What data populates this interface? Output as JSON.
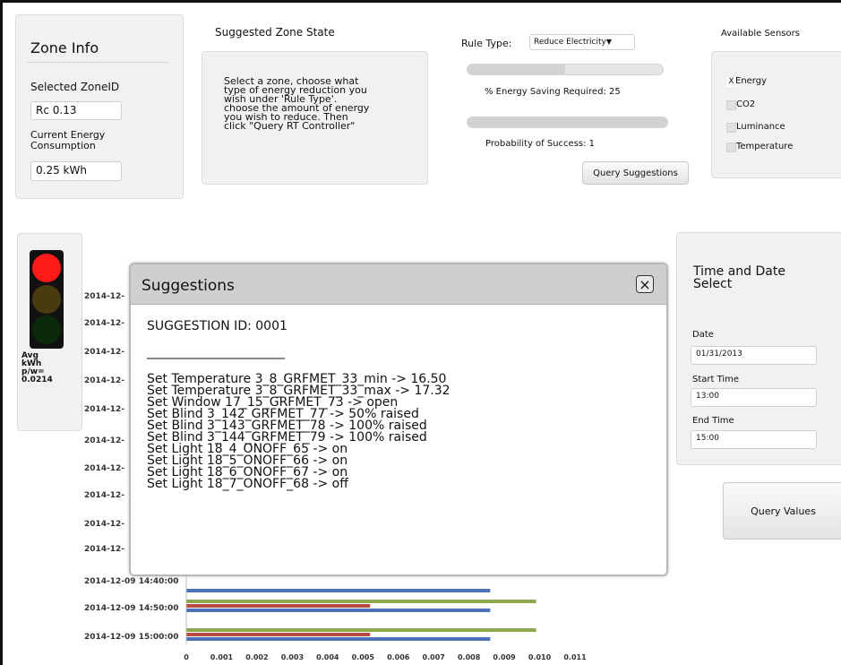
{
  "zone_info": {
    "title": "Zone Info",
    "selected_zone_label": "Selected ZoneID",
    "selected_zone_value": "Rc 0.13",
    "consumption_label_line1": "Current Energy",
    "consumption_label_line2": "Consumption",
    "consumption_value": "0.25 kWh"
  },
  "suggested_state": {
    "title": "Suggested Zone State",
    "instructions": [
      "Select a zone, choose what",
      "type of energy reduction you",
      "wish under 'Rule Type'.",
      "choose the amount of energy",
      "you wish to reduce. Then",
      "click \"Query RT Controller\""
    ]
  },
  "rule": {
    "label": "Rule Type:",
    "selected": "Reduce Electricity",
    "saving_label": "% Energy Saving Required: 25",
    "saving_value": 25,
    "probability_label": "Probability of Success: 1",
    "probability_value": 1,
    "query_button": "Query Suggestions"
  },
  "sensors": {
    "title": "Available Sensors",
    "items": [
      {
        "label": "Energy",
        "checked": true,
        "mark": "X"
      },
      {
        "label": "CO2",
        "checked": false,
        "mark": ""
      },
      {
        "label": "Luminance",
        "checked": false,
        "mark": ""
      },
      {
        "label": "Temperature",
        "checked": false,
        "mark": ""
      }
    ]
  },
  "traffic_light": {
    "colors": {
      "red": "#ff1a1a",
      "amber_dim": "#4a3a10",
      "green_dim": "#0b2a0b",
      "housing": "#111111"
    },
    "avg_label_lines": [
      "Avg",
      "kWh",
      "p/w=",
      "0.0214"
    ]
  },
  "time_select": {
    "title_line1": "Time and Date",
    "title_line2": "Select",
    "date_label": "Date",
    "date_value": "01/31/2013",
    "start_label": "Start Time",
    "start_value": "13:00",
    "end_label": "End Time",
    "end_value": "15:00",
    "query_button": "Query Values"
  },
  "chart_data": {
    "type": "bar",
    "orientation": "horizontal",
    "categories": [
      "2014-12-",
      "2014-12-",
      "2014-12-",
      "2014-12-",
      "2014-12-",
      "2014-12-",
      "2014-12-",
      "2014-12-",
      "2014-12-",
      "2014-12-",
      "2014-12-09 14:40:00",
      "2014-12-09 14:50:00",
      "2014-12-09 15:00:00"
    ],
    "visible_bars": [
      {
        "category_index": 10,
        "values": [
          null,
          null,
          0.0086
        ]
      },
      {
        "category_index": 11,
        "values": [
          0.0099,
          0.0052,
          0.0086
        ]
      },
      {
        "category_index": 12,
        "values": [
          0.0099,
          0.0052,
          0.0086
        ]
      }
    ],
    "series_colors": [
      "#8ea84e",
      "#b84a44",
      "#4a72b8"
    ],
    "x_ticks": [
      "0",
      "0.001",
      "0.002",
      "0.003",
      "0.004",
      "0.005",
      "0.006",
      "0.007",
      "0.008",
      "0.009",
      "0.010",
      "0.011"
    ],
    "xlim": [
      0,
      0.011
    ]
  },
  "suggestions": {
    "title": "Suggestions",
    "close_glyph": "×",
    "id_label": "SUGGESTION ID: 0001",
    "separator": "______________________",
    "lines": [
      "Set Temperature 3_8_GRFMET_33_min -> 16.50",
      "Set Temperature 3_8_GRFMET_33_max -> 17.32",
      "Set Window 17_15_GRFMET_73 -> open",
      "Set Blind 3_142_GRFMET_77 -> 50% raised",
      "Set Blind 3_143_GRFMET_78 -> 100% raised",
      "Set Blind 3_144_GRFMET_79 -> 100% raised",
      "Set Light 18_4_ONOFF_65 -> on",
      "Set Light 18_5_ONOFF_66 -> on",
      "Set Light 18_6_ONOFF_67 -> on",
      "Set Light 18_7_ONOFF_68 -> off"
    ]
  }
}
